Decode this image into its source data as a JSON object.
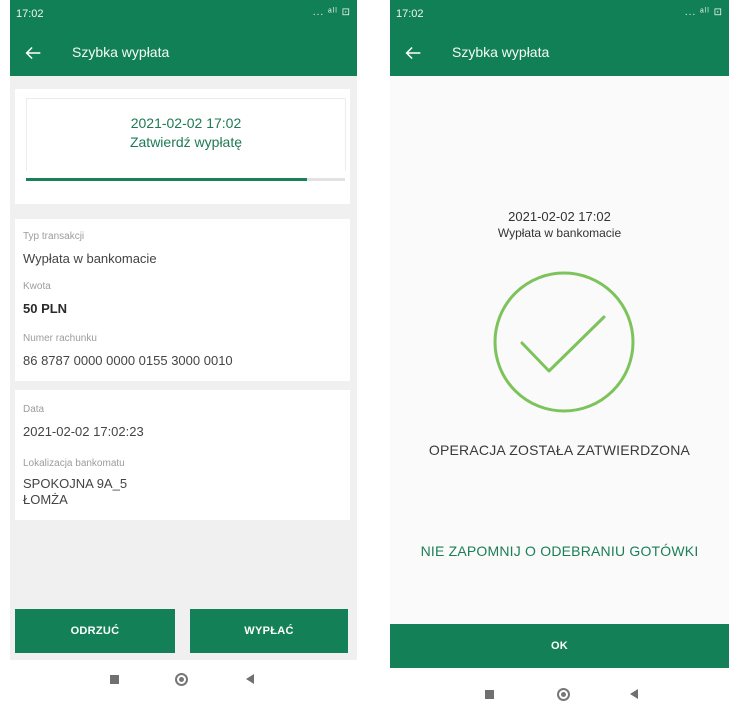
{
  "left": {
    "status": {
      "time": "17:02",
      "icons": "... ᵃˡˡ ⊡"
    },
    "appbar": {
      "title": "Szybka wypłata"
    },
    "progress": {
      "date": "2021-02-02 17:02",
      "label": "Zatwierdź wypłatę",
      "fraction": 0.88
    },
    "details1": {
      "type_label": "Typ transakcji",
      "type_value": "Wypłata w bankomacie",
      "amount_label": "Kwota",
      "amount_value": "50 PLN",
      "account_label": "Numer rachunku",
      "account_value": "86 8787 0000 0000 0155 3000 0010"
    },
    "details2": {
      "date_label": "Data",
      "date_value": "2021-02-02 17:02:23",
      "location_label": "Lokalizacja bankomatu",
      "location_line1": "SPOKOJNA 9A_5",
      "location_line2": "ŁOMŻA"
    },
    "buttons": {
      "reject": "ODRZUĆ",
      "withdraw": "WYPŁAĆ"
    }
  },
  "right": {
    "status": {
      "time": "17:02",
      "icons": "... ᵃˡˡ ⊡"
    },
    "appbar": {
      "title": "Szybka wypłata"
    },
    "date": "2021-02-02 17:02",
    "subtitle": "Wypłata w bankomacie",
    "status_text": "OPERACJA ZOSTAŁA ZATWIERDZONA",
    "reminder": "NIE ZAPOMNIJ O ODEBRANIU GOTÓWKI",
    "ok_label": "OK"
  },
  "colors": {
    "primary": "#128057",
    "check": "#7dc35b",
    "accent_text": "#1b7e58"
  },
  "icons": [
    "back-arrow-icon",
    "check-circle-icon",
    "nav-recent-icon",
    "nav-home-icon",
    "nav-back-icon"
  ]
}
